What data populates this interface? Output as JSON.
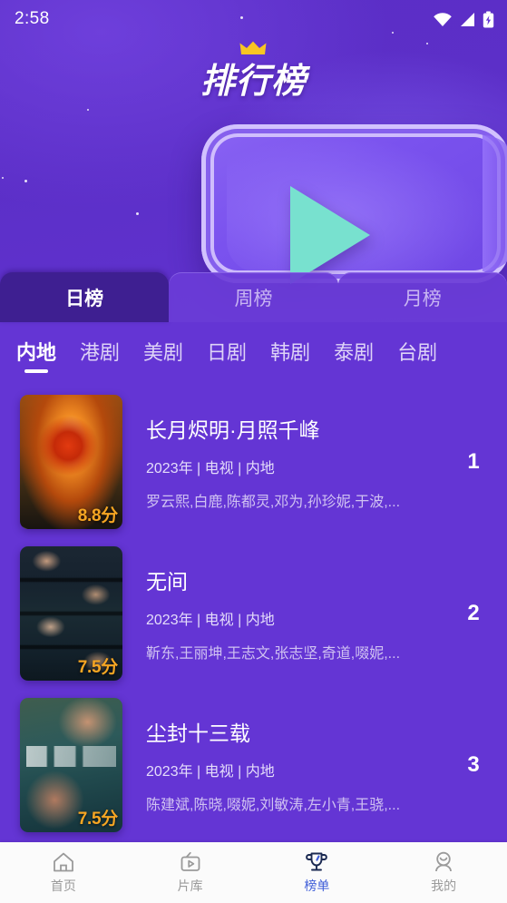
{
  "status_bar": {
    "time": "2:58",
    "icons": [
      "wifi-icon",
      "signal-icon",
      "battery-charging-icon"
    ]
  },
  "hero": {
    "title": "排行榜",
    "crown_icon": "crown-icon",
    "play_icon": "play-triangle-icon",
    "accent_purple": "#6435d4",
    "hero_purple": "#5b2ec6",
    "play_green": "#62ddc8",
    "crown_gold": "#f8c623"
  },
  "period_tabs": [
    {
      "label": "日榜",
      "active": true
    },
    {
      "label": "周榜",
      "active": false
    },
    {
      "label": "月榜",
      "active": false
    }
  ],
  "categories": [
    {
      "label": "内地",
      "active": true
    },
    {
      "label": "港剧",
      "active": false
    },
    {
      "label": "美剧",
      "active": false
    },
    {
      "label": "日剧",
      "active": false
    },
    {
      "label": "韩剧",
      "active": false
    },
    {
      "label": "泰剧",
      "active": false
    },
    {
      "label": "台剧",
      "active": false
    }
  ],
  "list": [
    {
      "rank": "1",
      "title": "长月烬明·月照千峰",
      "sub": "2023年 | 电视 | 内地",
      "cast": "罗云熙,白鹿,陈都灵,邓为,孙珍妮,于波,...",
      "score": "8.8分"
    },
    {
      "rank": "2",
      "title": "无间",
      "sub": "2023年 | 电视 | 内地",
      "cast": "靳东,王丽坤,王志文,张志坚,奇道,啜妮,...",
      "score": "7.5分"
    },
    {
      "rank": "3",
      "title": "尘封十三载",
      "sub": "2023年 | 电视 | 内地",
      "cast": "陈建斌,陈晓,啜妮,刘敏涛,左小青,王骁,...",
      "score": "7.5分"
    }
  ],
  "bottom_nav": {
    "active_color": "#3f5ed8",
    "inactive_color": "#9a9a9a",
    "items": [
      {
        "label": "首页",
        "icon": "home-icon",
        "active": false
      },
      {
        "label": "片库",
        "icon": "tv-library-icon",
        "active": false
      },
      {
        "label": "榜单",
        "icon": "trophy-icon",
        "active": true
      },
      {
        "label": "我的",
        "icon": "person-icon",
        "active": false
      }
    ]
  }
}
